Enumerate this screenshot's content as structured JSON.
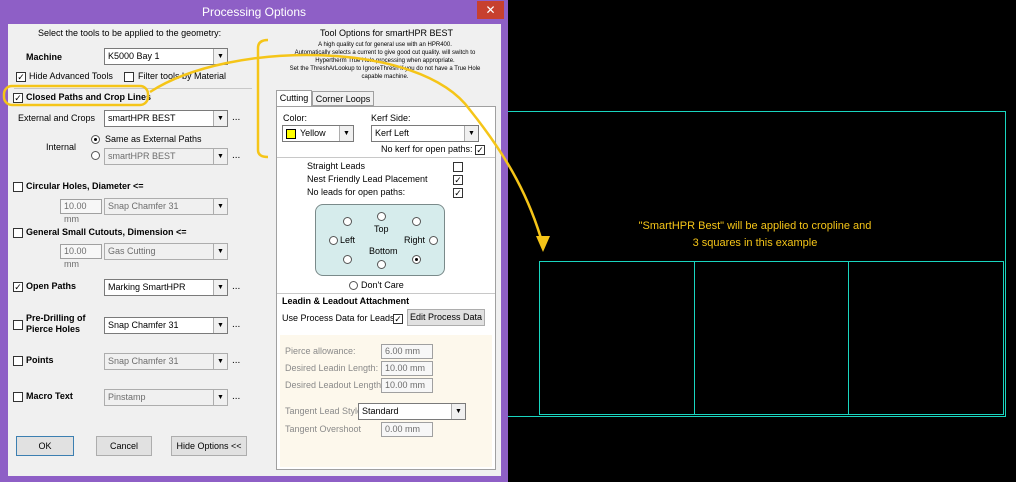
{
  "window": {
    "title": "Processing Options",
    "close_label": "✕"
  },
  "left": {
    "heading": "Select the tools to be applied to the geometry:",
    "machine_label": "Machine",
    "machine_value": "K5000 Bay 1",
    "hide_advanced_label": "Hide Advanced Tools",
    "filter_tools_label": "Filter tools by Material",
    "closed_paths_label": "Closed Paths and Crop Lines",
    "external_label": "External and Crops",
    "external_value": "smartHPR BEST",
    "internal_label": "Internal",
    "same_as_label": "Same as External Paths",
    "internal_value": "smartHPR BEST",
    "circular_label": "Circular Holes, Diameter <=",
    "circular_size": "10.00 mm",
    "circular_tool": "Snap Chamfer 31",
    "small_cutouts_label": "General Small Cutouts, Dimension <=",
    "small_size": "10.00 mm",
    "small_tool": "Gas Cutting",
    "open_paths_label": "Open Paths",
    "open_tool": "Marking SmartHPR",
    "predrill_label_1": "Pre-Drilling of",
    "predrill_label_2": "Pierce Holes",
    "predrill_tool": "Snap Chamfer 31",
    "points_label": "Points",
    "points_tool": "Snap Chamfer 31",
    "macro_label": "Macro Text",
    "macro_tool": "Pinstamp",
    "ok_label": "OK",
    "cancel_label": "Cancel",
    "hide_options_label": "Hide Options <<",
    "ellipsis": "..."
  },
  "right": {
    "heading": "Tool Options for smartHPR BEST",
    "desc": [
      "A high quality cut for general use with an HPR400.",
      "Automatically selects a current to give good cut quality. will switch to",
      "Hypertherm True Hole processing when appropriate.",
      "Set the ThreshArLookup to IgnoreThresh if you do not have a True Hole",
      "capable machine."
    ],
    "tab_cutting": "Cutting",
    "tab_corner": "Corner Loops",
    "color_label": "Color:",
    "color_value": "Yellow",
    "kerf_label": "Kerf Side:",
    "kerf_value": "Kerf Left",
    "no_kerf_label": "No kerf for open paths:",
    "straight_label": "Straight Leads",
    "nest_label": "Nest Friendly Lead Placement",
    "noleads_label": "No leads for open paths:",
    "pos_top": "Top",
    "pos_left": "Left",
    "pos_right": "Right",
    "pos_bottom": "Bottom",
    "dont_care": "Don't Care",
    "leadin_heading": "Leadin & Leadout Attachment",
    "use_process_label": "Use Process Data for Leads",
    "edit_process_label": "Edit Process Data",
    "pierce_label": "Pierce allowance:",
    "pierce_value": "6.00 mm",
    "leadin_label": "Desired Leadin Length:",
    "leadin_value": "10.00 mm",
    "leadout_label": "Desired Leadout Length:",
    "leadout_value": "10.00 mm",
    "tangent_style_label": "Tangent Lead Style",
    "tangent_style_value": "Standard",
    "tangent_over_label": "Tangent Overshoot",
    "tangent_over_value": "0.00 mm"
  },
  "annotation": {
    "line1": "\"SmartHPR Best\" will be applied to cropline and",
    "line2": "3 squares in this example",
    "color": "#f5c518"
  },
  "colors": {
    "title_bar": "#8e5fc6",
    "close": "#c7402f",
    "geometry": "#19d5bf",
    "yellow_swatch": "#ffff00"
  }
}
